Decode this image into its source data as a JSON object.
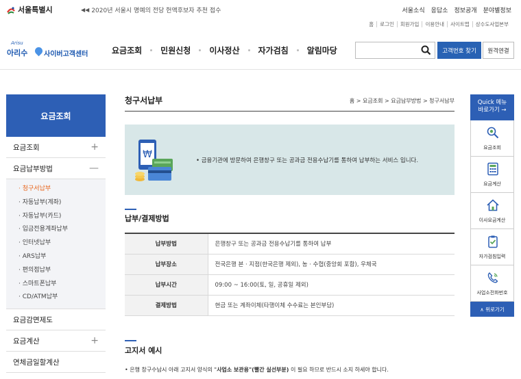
{
  "topbar": {
    "city": "서울특별시",
    "notice": "2020년 서울시 명예의 전당 헌액후보자 추천 접수",
    "links": [
      "서울소식",
      "응답소",
      "정보공개",
      "분야별정보"
    ]
  },
  "utilbar": {
    "links": [
      "홈",
      "로그인",
      "회원가입",
      "이용안내",
      "사이트맵",
      "상수도사업본부"
    ]
  },
  "header": {
    "brand_small": "Arisu",
    "brand_arisu": "아리수",
    "brand_center": "사이버고객센터",
    "gnb": [
      "요금조회",
      "민원신청",
      "이사정산",
      "자가검침",
      "알림마당"
    ],
    "search_placeholder": "",
    "find_button": "고객번호 찾기",
    "remote_button": "원격연결"
  },
  "lnb": {
    "title": "요금조회",
    "items": [
      {
        "label": "요금조회",
        "toggle": "+"
      },
      {
        "label": "요금납부방법",
        "toggle": "—"
      }
    ],
    "subitems": [
      "청구서납부",
      "자동납부(계좌)",
      "자동납부(카드)",
      "입금전용계좌납부",
      "인터넷납부",
      "ARS납부",
      "편의점납부",
      "스마트폰납부",
      "CD/ATM납부"
    ],
    "bottom_items": [
      {
        "label": "요금감면제도",
        "toggle": ""
      },
      {
        "label": "요금계산",
        "toggle": "+"
      },
      {
        "label": "연체금일할계산",
        "toggle": ""
      }
    ]
  },
  "content": {
    "title": "청구서납부",
    "breadcrumb": "홈 > 요금조회 > 요금납부방법 > 청구서납부",
    "intro": "• 금융기관에 방문하여 은행창구 또는 공과금 전용수납기를 통하여 납부하는 서비스 입니다.",
    "section1": "납부/결제방법",
    "table": [
      {
        "label": "납부방법",
        "value": "은행창구 또는 공과금 전용수납기를 통하여 납부"
      },
      {
        "label": "납부장소",
        "value": "전국은행 본 · 지점(한국은행 제외), 농 · 수협(중앙회 포함), 우체국"
      },
      {
        "label": "납부시간",
        "value": "09:00 ~ 16:00(토, 일, 공휴일 제외)"
      },
      {
        "label": "결제방법",
        "value": "현금 또는 계좌이체(타행이체 수수료는 본인부담)"
      }
    ],
    "section2": "고지서 예시",
    "note_prefix": "• 은행 창구수납시 아래 고지서 양식의 \"",
    "note_bold": "사업소 보관용\"(빨간 실선부분)",
    "note_suffix": " 이 필요 하므로 반드시 소지 하세야 합니다."
  },
  "quick": {
    "title_line1": "Quick 메뉴",
    "title_line2": "바로가기 →",
    "items": [
      "요금조회",
      "요금계산",
      "이사요금계산",
      "자가검침입력",
      "사업소전화번호"
    ],
    "top": "∧ 위로가기"
  },
  "colors": {
    "primary": "#2d5fb5",
    "active": "#e8651b",
    "intro_bg": "#d8e7e8"
  }
}
